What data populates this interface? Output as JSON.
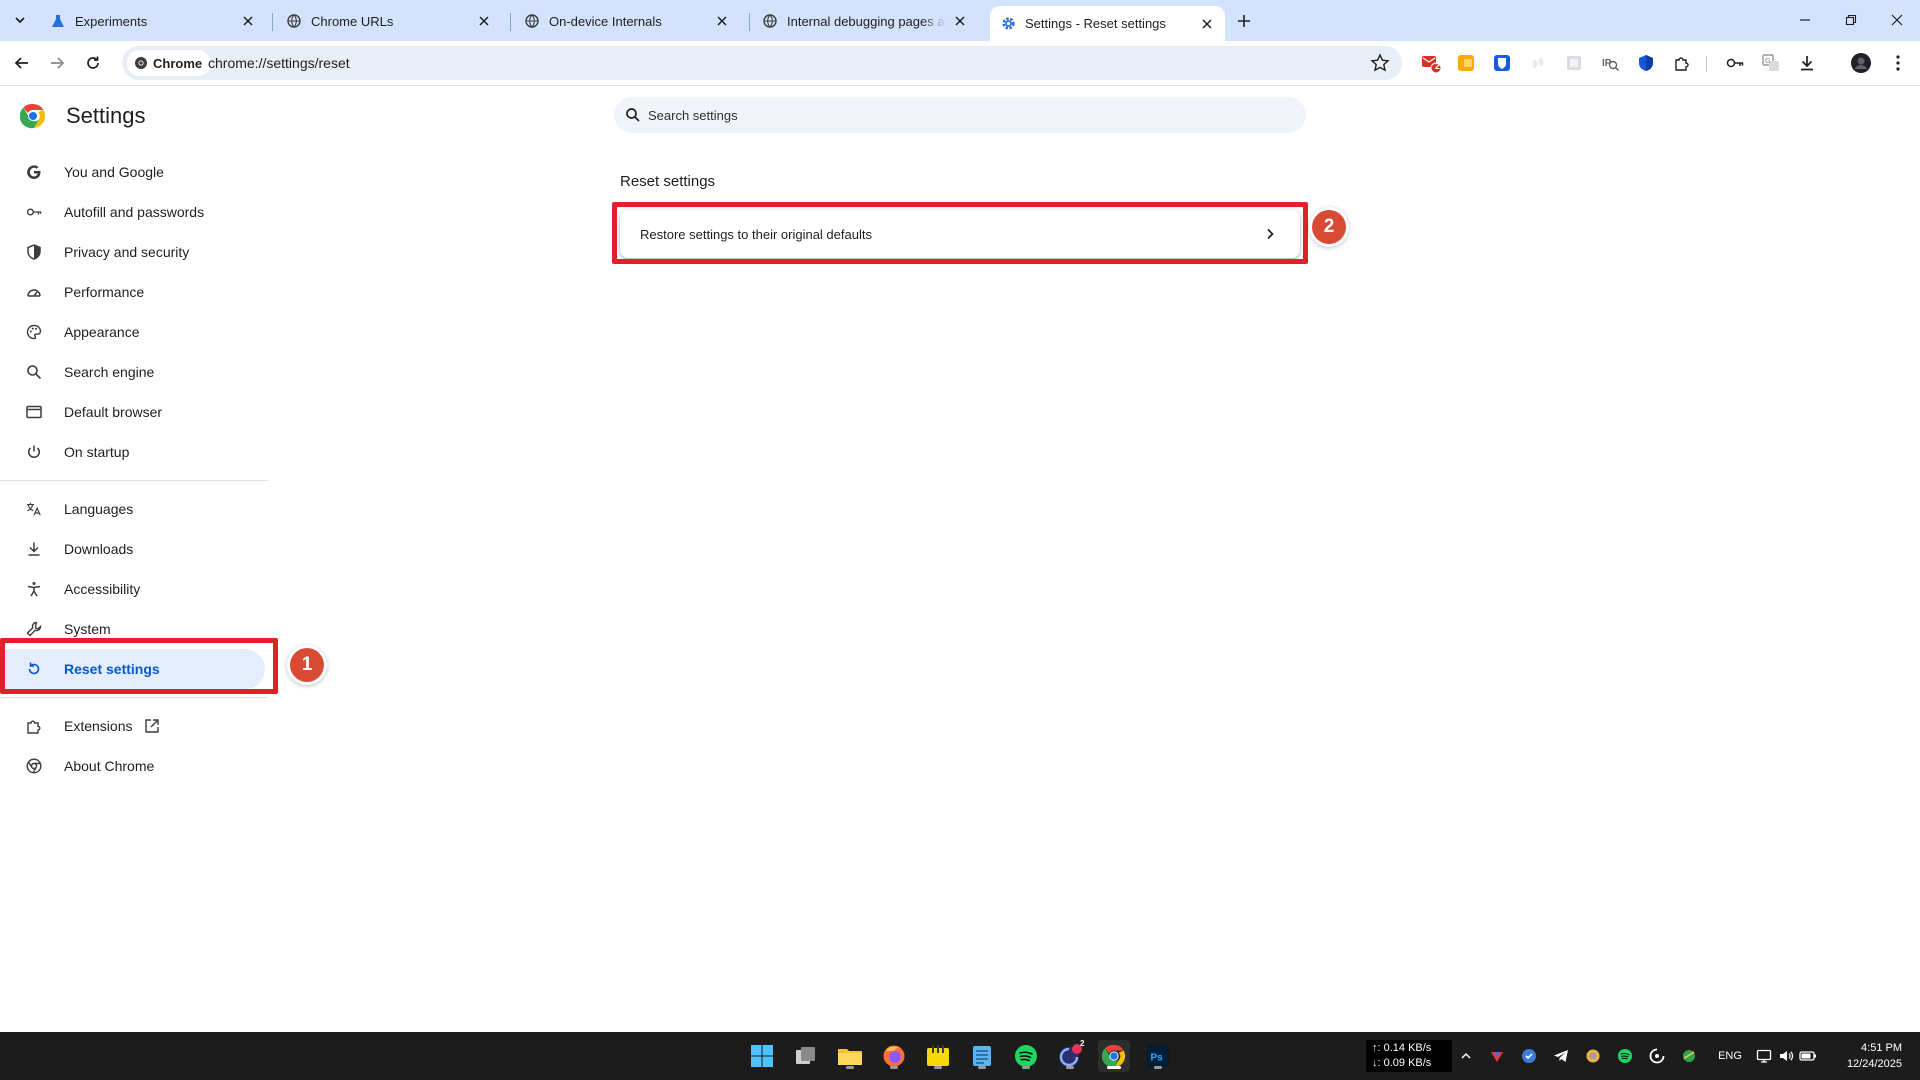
{
  "tabs": [
    {
      "title": "Experiments"
    },
    {
      "title": "Chrome URLs"
    },
    {
      "title": "On-device Internals"
    },
    {
      "title": "Internal debugging pages are c"
    },
    {
      "title": "Settings - Reset settings"
    }
  ],
  "omnibox": {
    "chip_label": "Chrome",
    "url": "chrome://settings/reset"
  },
  "extensions": {
    "mail_badge": "2"
  },
  "settings": {
    "title": "Settings",
    "search_placeholder": "Search settings",
    "nav": [
      {
        "label": "You and Google"
      },
      {
        "label": "Autofill and passwords"
      },
      {
        "label": "Privacy and security"
      },
      {
        "label": "Performance"
      },
      {
        "label": "Appearance"
      },
      {
        "label": "Search engine"
      },
      {
        "label": "Default browser"
      },
      {
        "label": "On startup"
      },
      {
        "label": "Languages"
      },
      {
        "label": "Downloads"
      },
      {
        "label": "Accessibility"
      },
      {
        "label": "System"
      },
      {
        "label": "Reset settings"
      },
      {
        "label": "Extensions"
      },
      {
        "label": "About Chrome"
      }
    ],
    "section_title": "Reset settings",
    "restore_row": "Restore settings to their original defaults"
  },
  "annotations": {
    "badge1": "1",
    "badge2": "2",
    "box_color": "#e0202a"
  },
  "taskbar": {
    "net_up": "↑: 0.14 KB/s",
    "net_down": "↓: 0.09 KB/s",
    "language": "ENG",
    "time": "4:51 PM",
    "date": "12/24/2025",
    "spotify_badge": "2"
  },
  "colors": {
    "accent": "#0b57d0",
    "tabstrip": "#d3e3fd",
    "selected_nav": "#e3edfb",
    "annotation_badge": "#d94a35"
  }
}
